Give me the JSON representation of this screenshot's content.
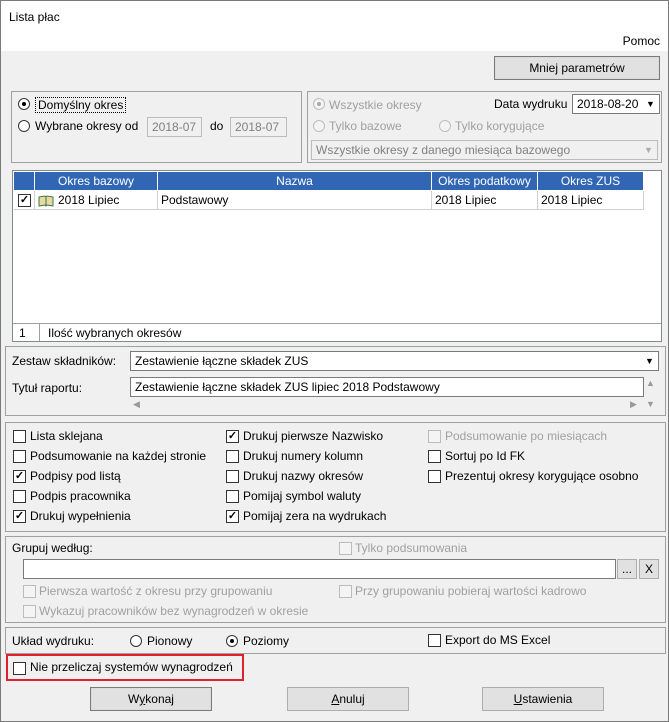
{
  "window": {
    "title": "Lista płac",
    "menu_help": "Pomoc"
  },
  "top_button": "Mniej parametrów",
  "period": {
    "default_label": "Domyślny  okres",
    "selected_label": "Wybrane okresy od",
    "from_value": "2018-07",
    "to_label": "do",
    "to_value": "2018-07"
  },
  "filter": {
    "all_label": "Wszystkie okresy",
    "base_label": "Tylko bazowe",
    "corrective_label": "Tylko korygujące",
    "print_date_label": "Data wydruku",
    "print_date_value": "2018-08-20",
    "scope_value": "Wszystkie okresy z danego miesiąca bazowego"
  },
  "grid": {
    "headers": [
      "Okres bazowy",
      "Nazwa",
      "Okres podatkowy",
      "Okres ZUS"
    ],
    "row": {
      "base": "2018 Lipiec",
      "name": "Podstawowy",
      "tax": "2018 Lipiec",
      "zus": "2018 Lipiec"
    },
    "footer_count": "1",
    "footer_label": "Ilość wybranych okresów"
  },
  "report": {
    "set_label": "Zestaw składników:",
    "set_value": "Zestawienie łączne składek ZUS",
    "title_label": "Tytuł raportu:",
    "title_value": "Zestawienie łączne składek ZUS lipiec 2018 Podstawowy"
  },
  "options": {
    "col1": [
      "Lista sklejana",
      "Podsumowanie na każdej stronie",
      "Podpisy pod listą",
      "Podpis pracownika",
      "Drukuj wypełnienia"
    ],
    "col2": [
      "Drukuj pierwsze Nazwisko",
      "Drukuj numery kolumn",
      "Drukuj nazwy okresów",
      "Pomijaj symbol waluty",
      "Pomijaj zera na wydrukach"
    ],
    "col3": [
      "Podsumowanie po miesiącach",
      "Sortuj po Id FK",
      "Prezentuj okresy korygujące osobno"
    ]
  },
  "group": {
    "label": "Grupuj według:",
    "only_summary": "Tylko podsumowania",
    "dots": "...",
    "clear": "X",
    "first_value": "Pierwsza wartość z okresu przy grupowaniu",
    "take_personnel": "Przy grupowaniu pobieraj wartości kadrowo",
    "show_without": "Wykazuj pracowników bez wynagrodzeń w okresie"
  },
  "layout": {
    "label": "Układ wydruku:",
    "vertical": "Pionowy",
    "horizontal": "Poziomy",
    "export_excel": "Export do MS Excel"
  },
  "no_recalc": "Nie przeliczaj systemów wynagrodzeń",
  "buttons": {
    "run_a": "W",
    "run_u": "y",
    "run_b": "konaj",
    "cancel_u": "A",
    "cancel_b": "nuluj",
    "settings_u": "U",
    "settings_b": "stawienia"
  },
  "colors": {
    "grid_header": "#3166b5",
    "highlight": "#e0202a"
  }
}
